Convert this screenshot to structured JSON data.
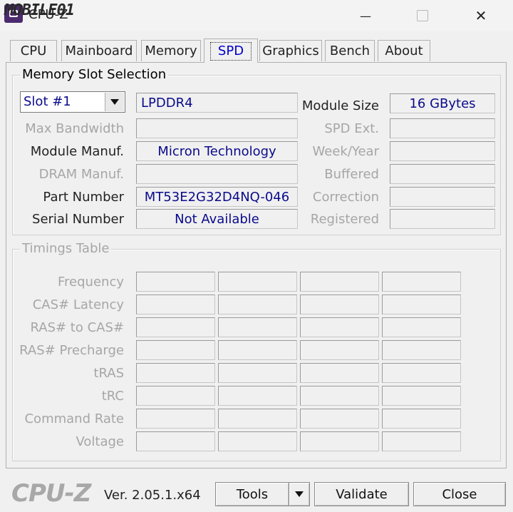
{
  "window": {
    "logo_text": "MOBILE01",
    "title": "CPU-Z",
    "close_glyph": "✕",
    "minimize_glyph": "—"
  },
  "tabs": [
    {
      "label": "CPU"
    },
    {
      "label": "Mainboard"
    },
    {
      "label": "Memory"
    },
    {
      "label": "SPD"
    },
    {
      "label": "Graphics"
    },
    {
      "label": "Bench"
    },
    {
      "label": "About"
    }
  ],
  "slot_selection": {
    "title": "Memory Slot Selection",
    "slot_value": "Slot #1",
    "memory_type": "LPDDR4",
    "labels": {
      "max_bandwidth": "Max Bandwidth",
      "module_manuf": "Module Manuf.",
      "dram_manuf": "DRAM Manuf.",
      "part_number": "Part Number",
      "serial_number": "Serial Number",
      "module_size": "Module Size",
      "spd_ext": "SPD Ext.",
      "week_year": "Week/Year",
      "buffered": "Buffered",
      "correction": "Correction",
      "registered": "Registered"
    },
    "values": {
      "max_bandwidth": "",
      "module_manuf": "Micron Technology",
      "dram_manuf": "",
      "part_number": "MT53E2G32D4NQ-046",
      "serial_number": "Not Available",
      "module_size": "16 GBytes",
      "spd_ext": "",
      "week_year": "",
      "buffered": "",
      "correction": "",
      "registered": ""
    }
  },
  "timings": {
    "title": "Timings Table",
    "rows": [
      "Frequency",
      "CAS# Latency",
      "RAS# to CAS#",
      "RAS# Precharge",
      "tRAS",
      "tRC",
      "Command Rate",
      "Voltage"
    ]
  },
  "footer": {
    "logo": "CPU-Z",
    "version": "Ver. 2.05.1.x64",
    "tools_label": "Tools",
    "validate_label": "Validate",
    "close_label": "Close"
  }
}
